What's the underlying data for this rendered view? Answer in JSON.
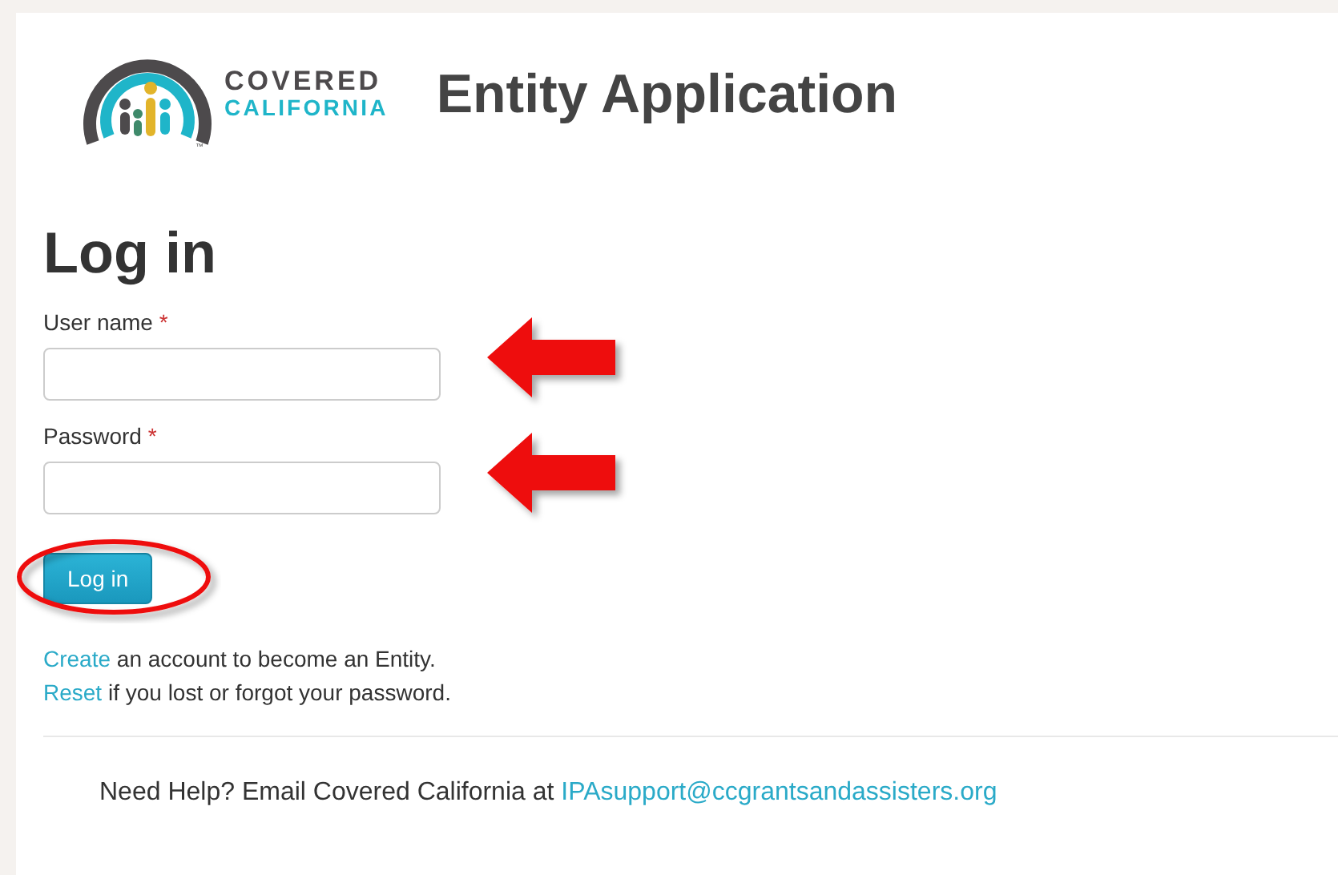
{
  "header": {
    "logo_line_1": "COVERED",
    "logo_line_2": "CALIFORNIA",
    "logo_mark": "™",
    "title": "Entity Application"
  },
  "login": {
    "heading": "Log in",
    "fields": [
      {
        "label": "User name",
        "required_mark": "*"
      },
      {
        "label": "Password",
        "required_mark": "*"
      }
    ],
    "button": "Log in",
    "links": [
      {
        "link": "Create",
        "text": " an account to become an Entity."
      },
      {
        "link": "Reset",
        "text": " if you lost or forgot your password."
      }
    ]
  },
  "footer": {
    "text": "Need Help? Email Covered California at ",
    "email": "IPAsupport@ccgrantsandassisters.org"
  }
}
